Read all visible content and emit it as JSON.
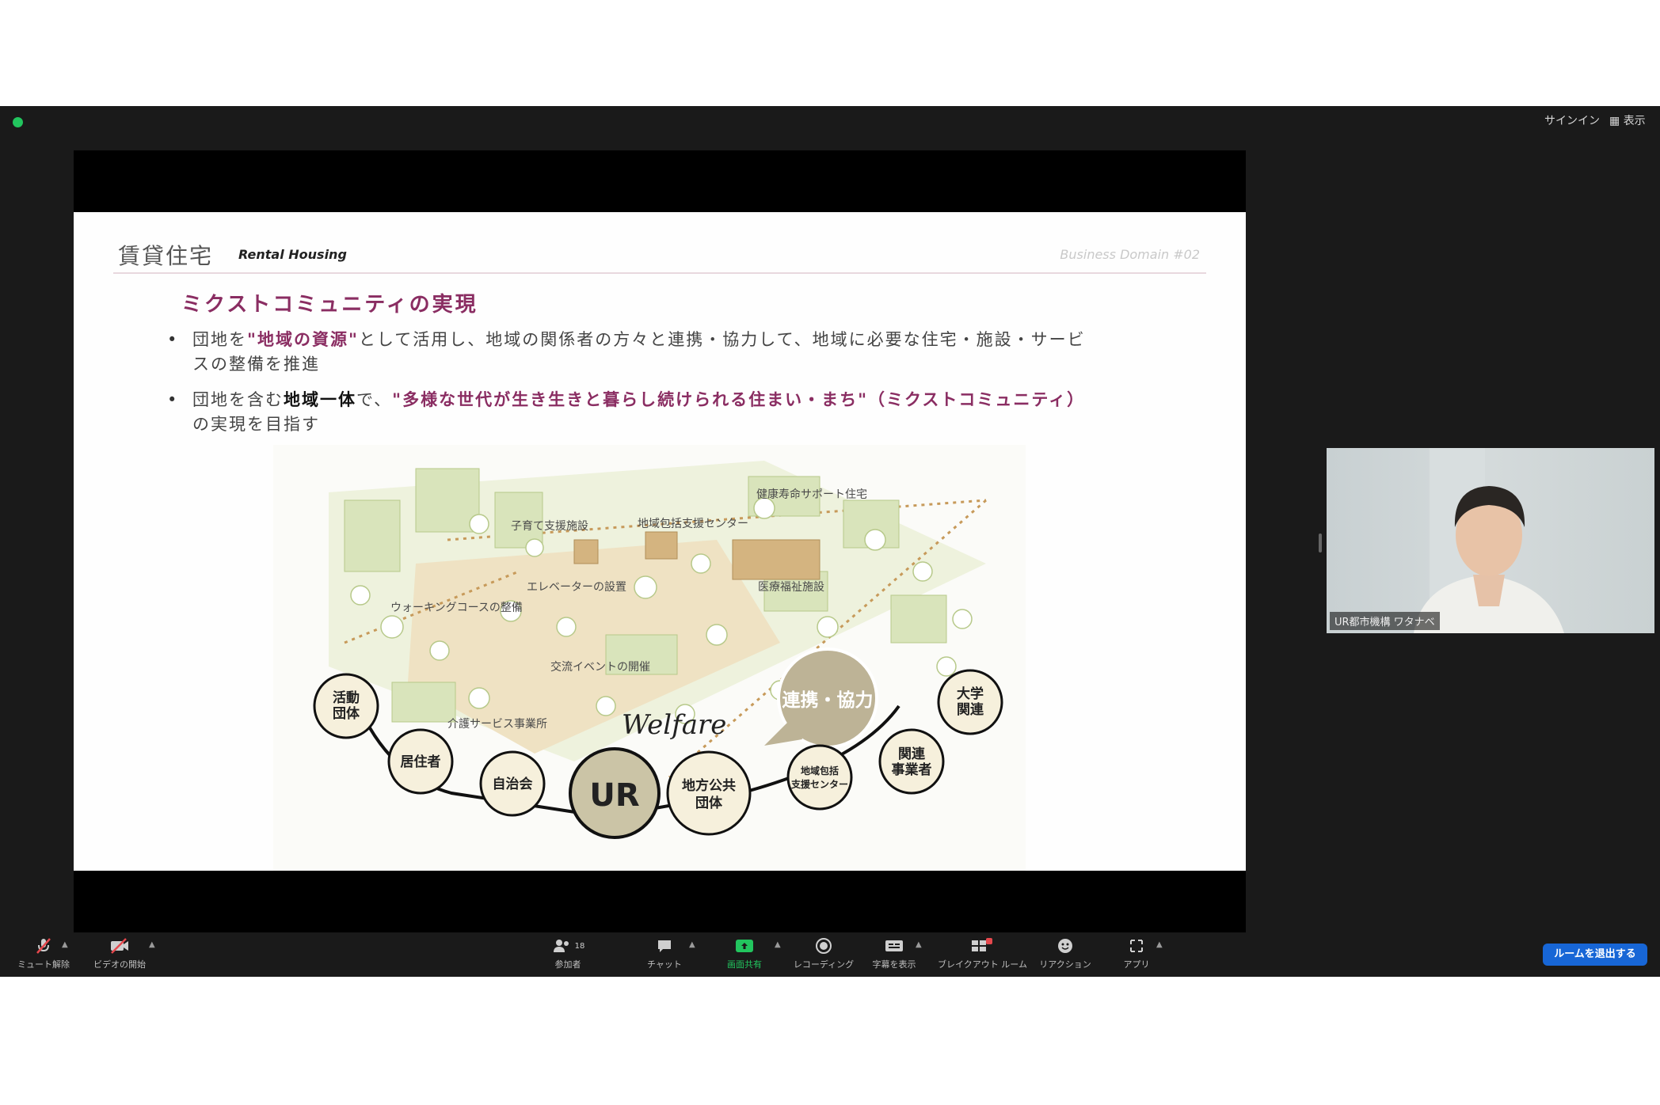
{
  "topbar": {
    "signin_label": "サインイン",
    "view_label": "表示"
  },
  "slide": {
    "title": "賃貸住宅",
    "subtitle": "Rental Housing",
    "domain_tag": "Business Domain #02",
    "heading": "ミクストコミュニティの実現",
    "bullet1": {
      "pre": "団地を",
      "hl": "\"地域の資源\"",
      "post": "として活用し、地域の関係者の方々と連携・協力して、地域に必要な住宅・施設・サービスの整備を推進"
    },
    "bullet2": {
      "pre": "団地を含む",
      "bold": "地域一体",
      "mid": "で、",
      "hl": "\"多様な世代が生き生きと暮らし続けられる住まい・まち\"（ミクストコミュニティ）",
      "post": "の実現を目指す"
    },
    "illustration": {
      "labels": {
        "support_housing": "健康寿命サポート住宅",
        "childcare": "子育て支援施設",
        "community_center": "地域包括支援センター",
        "elevator": "エレベーターの設置",
        "medical": "医療福祉施設",
        "walking": "ウォーキングコースの整備",
        "event": "交流イベントの開催",
        "care_service": "介護サービス事業所"
      },
      "welfare_logo": "Welfare",
      "bubble": "連携・協力",
      "nodes": {
        "activity_group": "活動\n団体",
        "resident": "居住者",
        "neighborhood": "自治会",
        "ur": "UR",
        "local_gov": "地方公共\n団体",
        "community_support": "地域包括\n支援センター",
        "related_business": "関連\n事業者",
        "university": "大学\n関連"
      }
    }
  },
  "video": {
    "name": "UR都市機構 ワタナベ"
  },
  "toolbar": {
    "mute": "ミュート解除",
    "video": "ビデオの開始",
    "participants": "参加者",
    "participants_count": "18",
    "chat": "チャット",
    "share": "画面共有",
    "record": "レコーディング",
    "captions": "字幕を表示",
    "breakout": "ブレイクアウト ルーム",
    "reactions": "リアクション",
    "apps": "アプリ",
    "leave": "ルームを退出する"
  },
  "colors": {
    "accent": "#8a2d62",
    "leave_button": "#1766d6",
    "status_green": "#22c55e",
    "illustration_green": "#c3d69a",
    "illustration_tan": "#c9b78a",
    "ur_node": "#cbc4a6"
  }
}
